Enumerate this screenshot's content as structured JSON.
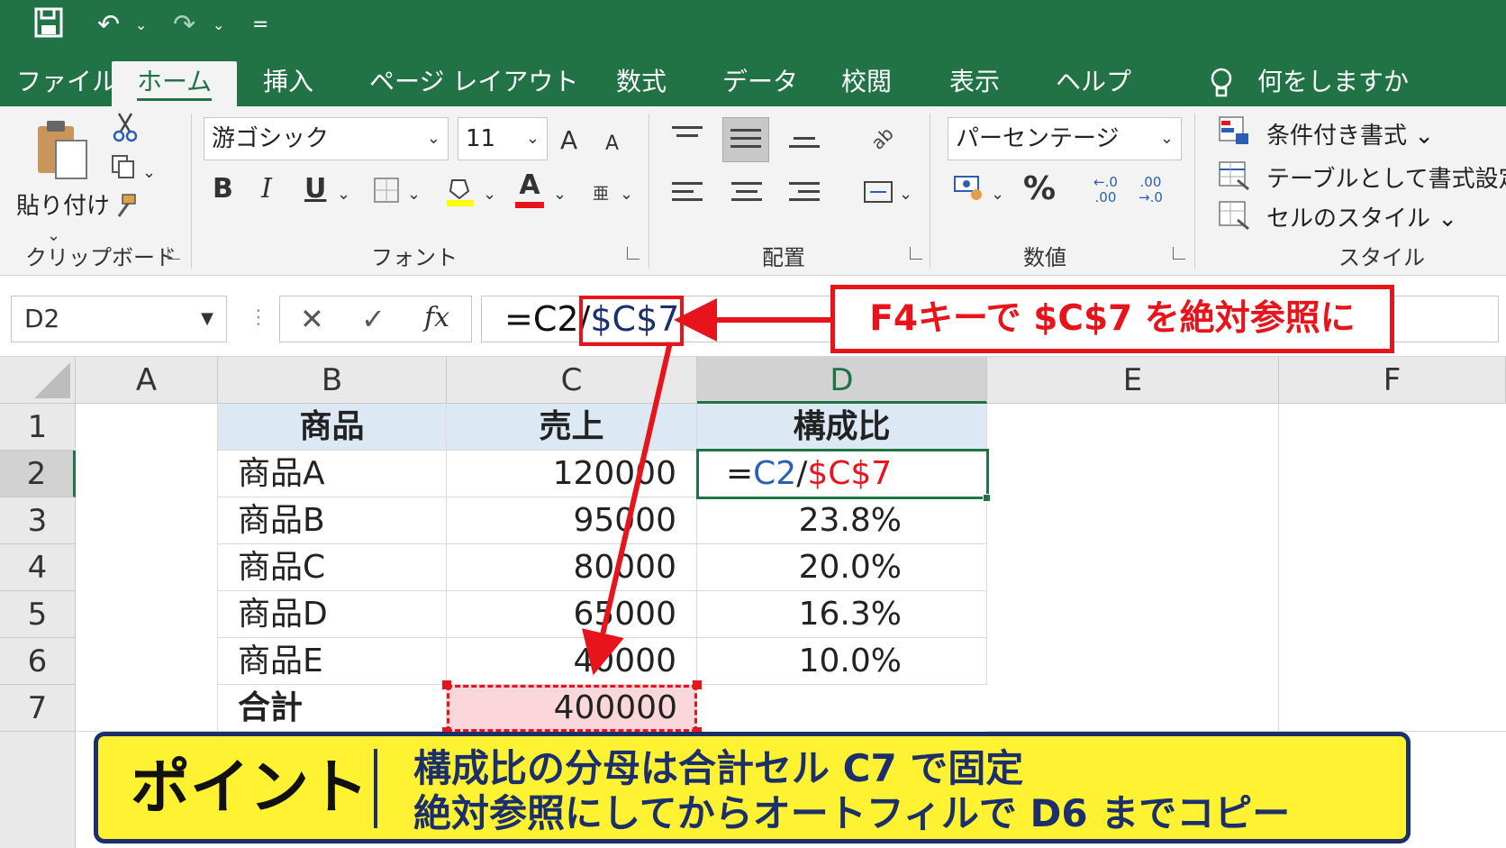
{
  "qat": {
    "save": "💾",
    "undo": "↶",
    "redo": "↷",
    "customize": "="
  },
  "tabs": [
    "ファイル",
    "ホーム",
    "挿入",
    "ページ レイアウト",
    "数式",
    "データ",
    "校閲",
    "表示",
    "ヘルプ"
  ],
  "tell_me": "何をしますか",
  "ribbon": {
    "clipboard": {
      "paste_label": "貼り付け",
      "group": "クリップボード"
    },
    "font": {
      "font_name": "游ゴシック",
      "font_size": "11",
      "bold": "B",
      "italic": "I",
      "underline": "U",
      "font_color_glyph": "A",
      "grow": "A",
      "shrink": "A",
      "group": "フォント"
    },
    "alignment": {
      "group": "配置"
    },
    "number": {
      "format": "パーセンテージ",
      "percent": "%",
      "inc_decimal": "←.0\n.00",
      "dec_decimal": ".00\n→.0",
      "group": "数値"
    },
    "styles": {
      "conditional": "条件付き書式",
      "as_table": "テーブルとして書式設定",
      "cell_styles": "セルのスタイル",
      "group": "スタイル"
    }
  },
  "formula_bar": {
    "name_box": "D2",
    "cancel": "✕",
    "enter": "✓",
    "fx": "fx",
    "formula_prefix": "=C2/",
    "formula_abs": "$C$7"
  },
  "callout": "F4キーで $C$7 を絶対参照に",
  "columns": [
    "A",
    "B",
    "C",
    "D",
    "E",
    "F"
  ],
  "rows": [
    "1",
    "2",
    "3",
    "4",
    "5",
    "6",
    "7"
  ],
  "table": {
    "headers": [
      "商品",
      "売上",
      "構成比"
    ],
    "items": [
      {
        "name": "商品A",
        "sales": "120000",
        "ratio": ""
      },
      {
        "name": "商品B",
        "sales": "95000",
        "ratio": "23.8%"
      },
      {
        "name": "商品C",
        "sales": "80000",
        "ratio": "20.0%"
      },
      {
        "name": "商品D",
        "sales": "65000",
        "ratio": "16.3%"
      },
      {
        "name": "商品E",
        "sales": "40000",
        "ratio": "10.0%"
      }
    ],
    "total_label": "合計",
    "total_value": "400000",
    "d2_eq": "=",
    "d2_rel": "C2",
    "d2_slash": "/",
    "d2_abs": "$C$7"
  },
  "point": {
    "title": "ポイント",
    "line1": "構成比の分母は合計セル C7 で固定",
    "line2": "絶対参照にしてからオートフィルで D6 までコピー"
  },
  "colors": {
    "excel_green": "#217346",
    "accent_red": "#e8141b",
    "point_yellow": "#fff233",
    "navy": "#1a2f6b"
  }
}
